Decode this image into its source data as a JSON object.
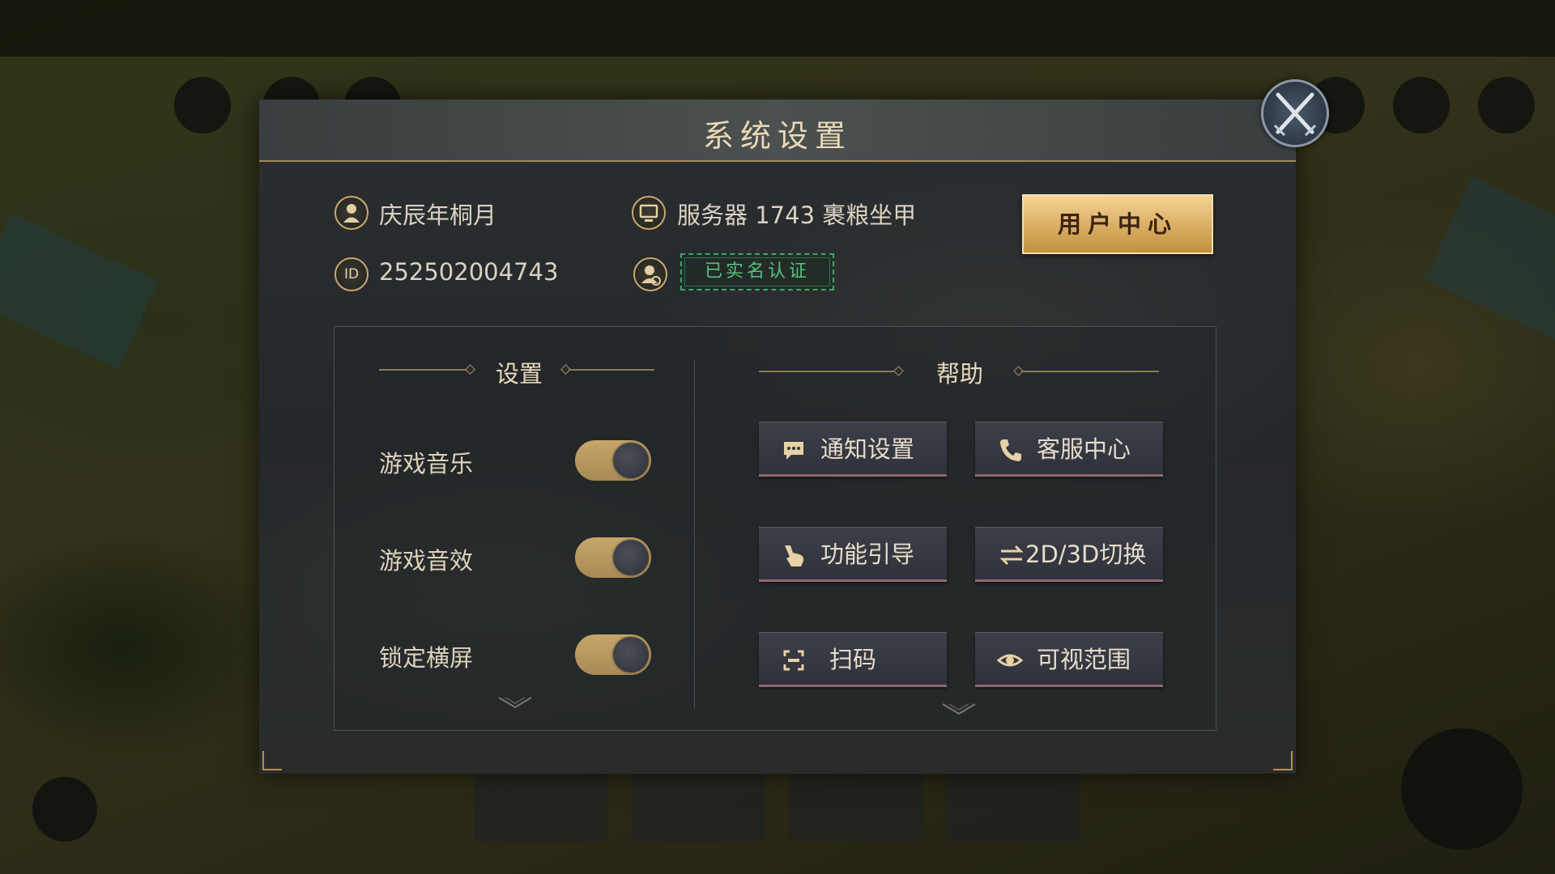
{
  "dialog": {
    "title": "系统设置",
    "player_name": "庆辰年桐月",
    "server": "服务器 1743 裹粮坐甲",
    "id_badge": "ID",
    "player_id": "252502004743",
    "verified_label": "已实名认证",
    "user_center_label": "用户中心"
  },
  "settings": {
    "title": "设置",
    "items": [
      {
        "label": "游戏音乐",
        "enabled": true
      },
      {
        "label": "游戏音效",
        "enabled": true
      },
      {
        "label": "锁定横屏",
        "enabled": true
      }
    ]
  },
  "help": {
    "title": "帮助",
    "buttons": [
      {
        "label": "通知设置",
        "icon": "message-icon"
      },
      {
        "label": "客服中心",
        "icon": "phone-icon"
      },
      {
        "label": "功能引导",
        "icon": "pointer-hand-icon"
      },
      {
        "label": "2D/3D切换",
        "icon": "swap-arrows-icon"
      },
      {
        "label": "扫码",
        "icon": "scan-icon"
      },
      {
        "label": "可视范围",
        "icon": "eye-icon"
      }
    ]
  },
  "colors": {
    "accent_gold": "#d9ad62",
    "verified_green": "#55c27c",
    "panel_bg": "#2b2e30"
  }
}
